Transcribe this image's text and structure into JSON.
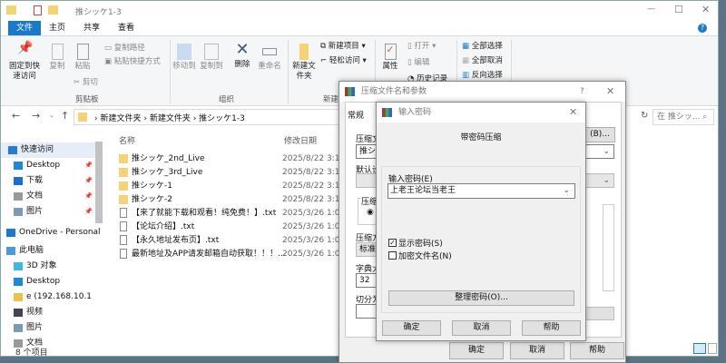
{
  "window": {
    "title": "推シッケ1-3",
    "minimize": "—",
    "maximize": "☐",
    "close": "✕",
    "help": "?"
  },
  "tabs": [
    "文件",
    "主页",
    "共享",
    "查看"
  ],
  "ribbon": {
    "clipboard": {
      "pin": "固定到快速访问",
      "copy": "复制",
      "paste": "粘贴",
      "copy_path": "复制路径",
      "paste_shortcut": "粘贴快捷方式",
      "cut": "剪切",
      "group": "剪贴板"
    },
    "organize": {
      "move_to": "移动到",
      "copy_to": "复制到",
      "delete": "删除",
      "rename": "重命名",
      "group": "组织"
    },
    "new": {
      "new_folder": "新建文件夹",
      "new_item": "新建项目 ▾",
      "easy_access": "轻松访问 ▾",
      "group": "新建"
    },
    "open": {
      "properties": "属性",
      "open": "打开 ▾",
      "edit": "编辑",
      "history": "历史记录"
    },
    "select": {
      "select_all": "全部选择",
      "select_none": "全部取消",
      "invert": "反向选择"
    }
  },
  "address": {
    "breadcrumb": [
      "新建文件夹",
      "新建文件夹",
      "推シッケ1-3"
    ],
    "search_placeholder": "在 推シッ... ⌕"
  },
  "nav": {
    "items": [
      {
        "label": "快速访问",
        "icon": "star-icon"
      },
      {
        "label": "Desktop",
        "icon": "desktop-icon",
        "pinned": true
      },
      {
        "label": "下载",
        "icon": "download-icon",
        "pinned": true
      },
      {
        "label": "文档",
        "icon": "document-icon",
        "pinned": true
      },
      {
        "label": "图片",
        "icon": "pictures-icon",
        "pinned": true
      },
      {
        "label": "OneDrive - Personal",
        "icon": "cloud-icon"
      },
      {
        "label": "此电脑",
        "icon": "computer-icon"
      },
      {
        "label": "3D 对象",
        "icon": "cube-icon"
      },
      {
        "label": "Desktop",
        "icon": "desktop-icon"
      },
      {
        "label": "e (192.168.10.1",
        "icon": "network-drive-icon"
      },
      {
        "label": "视频",
        "icon": "video-icon"
      },
      {
        "label": "图片",
        "icon": "pictures-icon"
      },
      {
        "label": "文档",
        "icon": "document-icon"
      }
    ]
  },
  "files": {
    "headers": {
      "name": "名称",
      "date": "修改日期"
    },
    "rows": [
      {
        "name": "推シッケ_2nd_Live",
        "date": "2025/8/22 3:18",
        "type": "folder"
      },
      {
        "name": "推シッケ_3rd_Live",
        "date": "2025/8/22 3:18",
        "type": "folder"
      },
      {
        "name": "推シッケ-1",
        "date": "2025/8/22 3:17",
        "type": "folder"
      },
      {
        "name": "推シッケ-2",
        "date": "2025/8/22 3:17",
        "type": "folder"
      },
      {
        "name": "【来了就能下载和观看！纯免费！】.txt",
        "date": "2025/3/26 1:07",
        "type": "txt"
      },
      {
        "name": "【论坛介绍】.txt",
        "date": "2025/3/26 1:08",
        "type": "txt"
      },
      {
        "name": "【永久地址发布页】.txt",
        "date": "2025/3/26 1:08",
        "type": "txt"
      },
      {
        "name": "最新地址及APP请发邮箱自动获取！！！....",
        "date": "2025/3/26 1:08",
        "type": "txt"
      }
    ]
  },
  "status": "8 个项目",
  "archive_dialog": {
    "title": "压缩文件名和参数",
    "tab": "常规",
    "archive_name_label": "压缩文",
    "archive_name": "推シッ",
    "browse": "(B)...",
    "profile_label": "默认设",
    "format_group": "压缩",
    "format_radio": "R",
    "method_label": "压缩方",
    "method": "标准",
    "dict_label": "字典大",
    "dict": "32",
    "split_label": "切分为",
    "ok": "确定",
    "cancel": "取消",
    "help": "帮助"
  },
  "password_dialog": {
    "title": "输入密码",
    "heading": "带密码压缩",
    "password_label": "输入密码(E)",
    "password": "上老王论坛当老王",
    "show_password": "显示密码(S)",
    "show_password_checked": true,
    "encrypt_names": "加密文件名(N)",
    "encrypt_names_checked": false,
    "organize": "整理密码(O)...",
    "ok": "确定",
    "cancel": "取消",
    "help": "帮助"
  },
  "colors": {
    "accent": "#1979ca",
    "folder": "#f6d277"
  }
}
